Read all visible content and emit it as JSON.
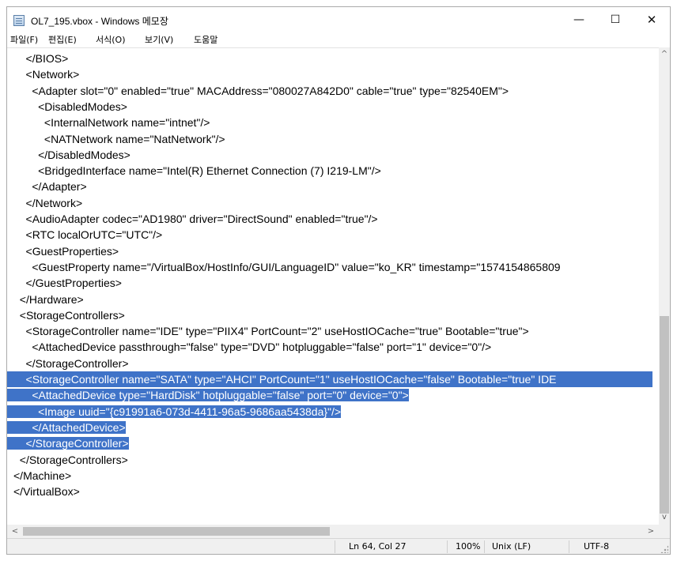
{
  "window": {
    "title": "OL7_195.vbox - Windows 메모장",
    "icon": "notepad-icon",
    "controls": {
      "minimize": "—",
      "maximize": "☐",
      "close": "✕"
    }
  },
  "menu": [
    "파일(F)",
    "편집(E)",
    "서식(O)",
    "보기(V)",
    "도움말"
  ],
  "editor": {
    "lines": [
      {
        "text": "    </BIOS>",
        "selected": false
      },
      {
        "text": "    <Network>",
        "selected": false
      },
      {
        "text": "      <Adapter slot=\"0\" enabled=\"true\" MACAddress=\"080027A842D0\" cable=\"true\" type=\"82540EM\">",
        "selected": false
      },
      {
        "text": "        <DisabledModes>",
        "selected": false
      },
      {
        "text": "          <InternalNetwork name=\"intnet\"/>",
        "selected": false
      },
      {
        "text": "          <NATNetwork name=\"NatNetwork\"/>",
        "selected": false
      },
      {
        "text": "        </DisabledModes>",
        "selected": false
      },
      {
        "text": "        <BridgedInterface name=\"Intel(R) Ethernet Connection (7) I219-LM\"/>",
        "selected": false
      },
      {
        "text": "      </Adapter>",
        "selected": false
      },
      {
        "text": "    </Network>",
        "selected": false
      },
      {
        "text": "    <AudioAdapter codec=\"AD1980\" driver=\"DirectSound\" enabled=\"true\"/>",
        "selected": false
      },
      {
        "text": "    <RTC localOrUTC=\"UTC\"/>",
        "selected": false
      },
      {
        "text": "    <GuestProperties>",
        "selected": false
      },
      {
        "text": "      <GuestProperty name=\"/VirtualBox/HostInfo/GUI/LanguageID\" value=\"ko_KR\" timestamp=\"1574154865809",
        "selected": false
      },
      {
        "text": "    </GuestProperties>",
        "selected": false
      },
      {
        "text": "  </Hardware>",
        "selected": false
      },
      {
        "text": "  <StorageControllers>",
        "selected": false
      },
      {
        "text": "    <StorageController name=\"IDE\" type=\"PIIX4\" PortCount=\"2\" useHostIOCache=\"true\" Bootable=\"true\">",
        "selected": false
      },
      {
        "text": "      <AttachedDevice passthrough=\"false\" type=\"DVD\" hotpluggable=\"false\" port=\"1\" device=\"0\"/>",
        "selected": false
      },
      {
        "text": "    </StorageController>",
        "selected": false
      },
      {
        "text": "    <StorageController name=\"SATA\" type=\"AHCI\" PortCount=\"1\" useHostIOCache=\"false\" Bootable=\"true\" IDE",
        "selected": true,
        "fill": true
      },
      {
        "text": "      <AttachedDevice type=\"HardDisk\" hotpluggable=\"false\" port=\"0\" device=\"0\">",
        "selected": true,
        "fill": false
      },
      {
        "text": "        <Image uuid=\"{c91991a6-073d-4411-96a5-9686aa5438da}\"/>",
        "selected": true,
        "fill": false
      },
      {
        "text": "      </AttachedDevice>",
        "selected": true,
        "fill": false
      },
      {
        "text": "    </StorageController>",
        "selected": true,
        "fill": false
      },
      {
        "text": "  </StorageControllers>",
        "selected": false
      },
      {
        "text": "</Machine>",
        "selected": false
      },
      {
        "text": "</VirtualBox>",
        "selected": false
      }
    ]
  },
  "scrollbars": {
    "vertical": {
      "up": "^",
      "down": "v"
    },
    "horizontal": {
      "left": "<",
      "right": ">"
    }
  },
  "statusbar": {
    "position": "Ln 64, Col 27",
    "zoom": "100%",
    "line_ending": "Unix (LF)",
    "encoding": "UTF-8"
  },
  "colors": {
    "selection": "#3f73c8",
    "scrollbar_thumb": "#c1c1c1"
  }
}
